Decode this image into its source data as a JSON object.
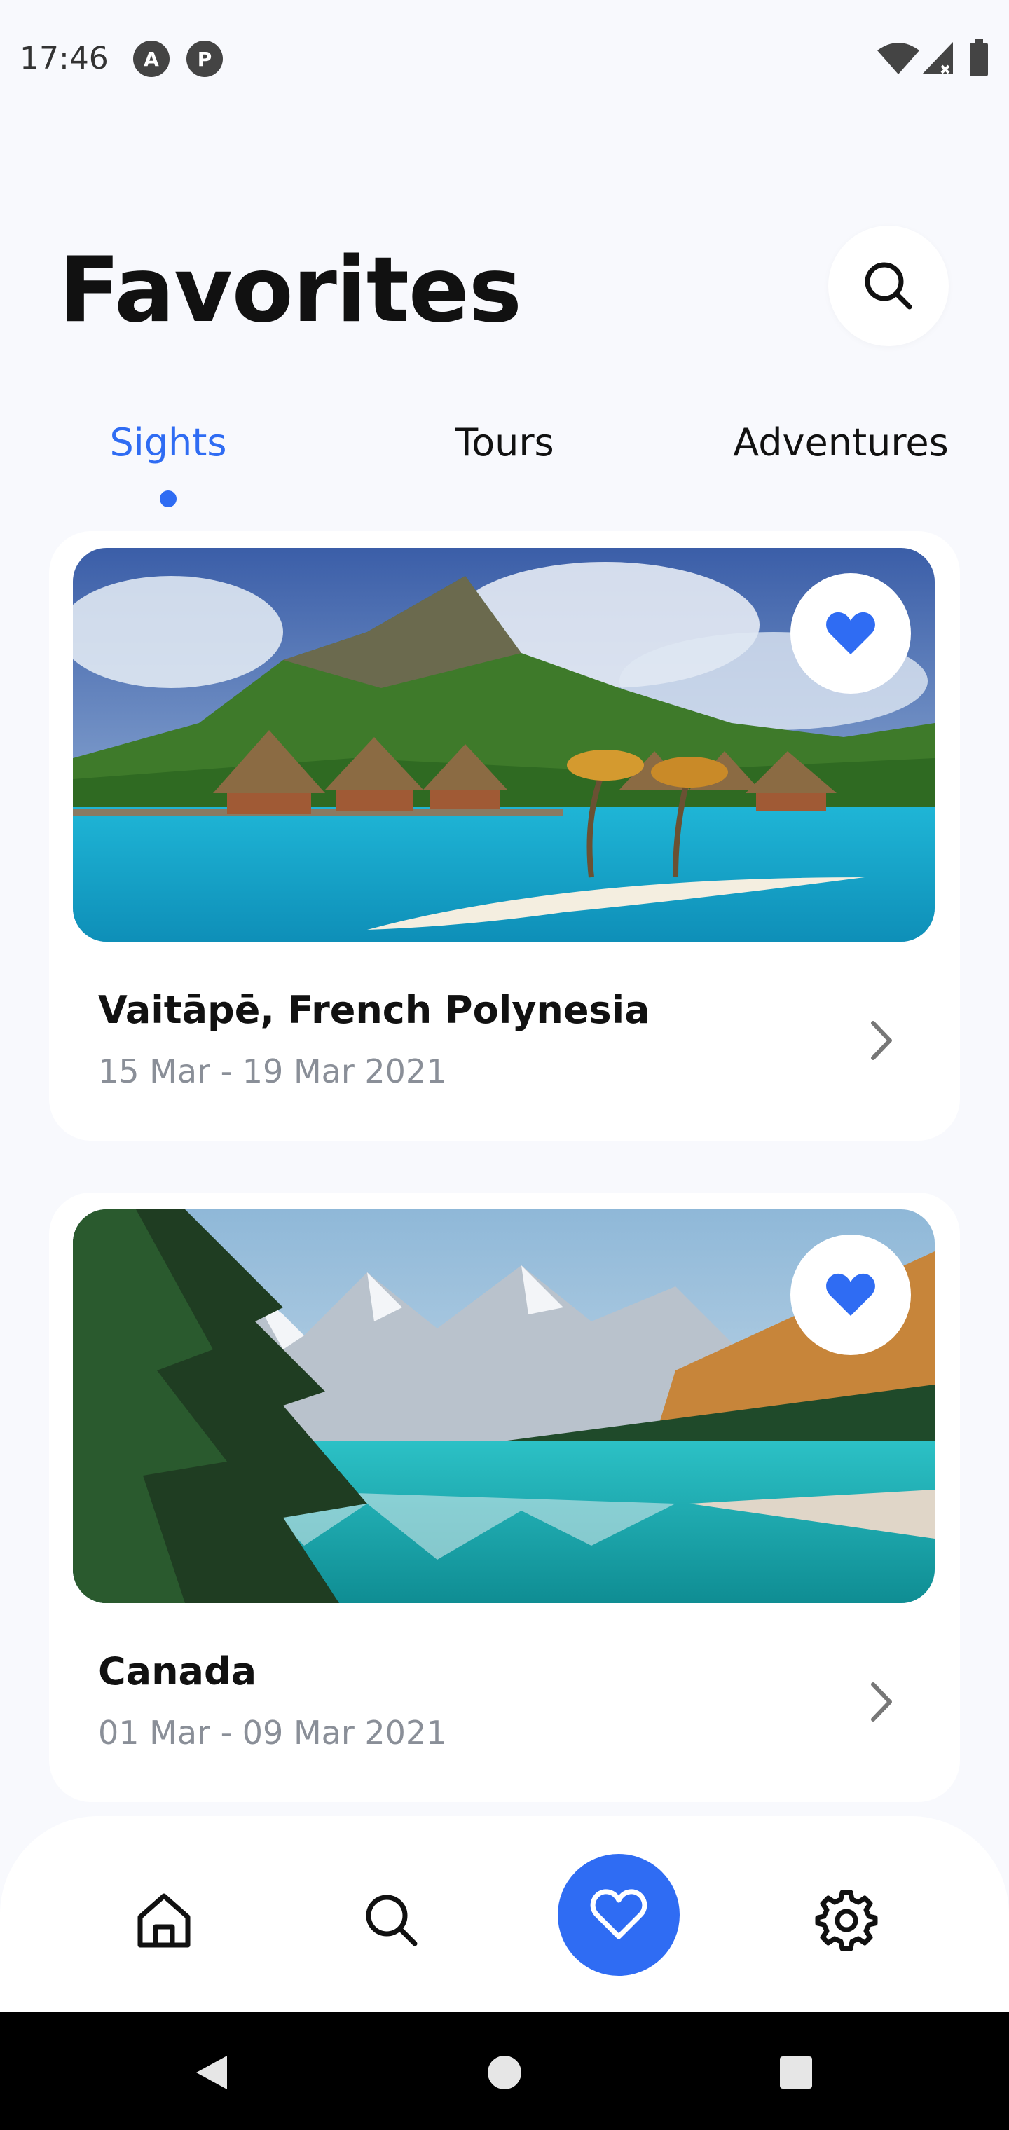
{
  "status_bar": {
    "time": "17:46",
    "app_icons": [
      "A",
      "P"
    ]
  },
  "header": {
    "title": "Favorites",
    "search_icon": "search-icon"
  },
  "tabs": [
    {
      "label": "Sights",
      "active": true
    },
    {
      "label": "Tours",
      "active": false
    },
    {
      "label": "Adventures",
      "active": false
    }
  ],
  "cards": [
    {
      "place": "Vaitāpē, French Polynesia",
      "dates": "15 Mar - 19 Mar 2021",
      "favorited": true
    },
    {
      "place": "Canada",
      "dates": "01 Mar - 09 Mar 2021",
      "favorited": true
    }
  ],
  "bottom_nav": {
    "items": [
      "home-icon",
      "search-icon",
      "heart-icon",
      "gear-icon"
    ],
    "active": "heart-icon"
  },
  "colors": {
    "accent": "#2f6cf3",
    "background": "#f8f9fd",
    "card": "#ffffff",
    "muted_text": "#8a8f98"
  }
}
